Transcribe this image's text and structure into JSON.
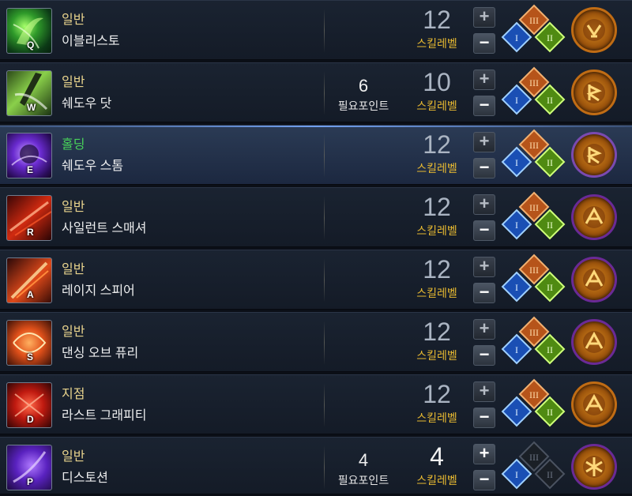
{
  "skills": [
    {
      "key": "Q",
      "type": "일반",
      "name": "이블리스토",
      "points": "",
      "points_label": "",
      "level": "12",
      "level_label": "스킬레벨",
      "tripods": [
        "III",
        "I",
        "II"
      ],
      "rune": "gold"
    },
    {
      "key": "W",
      "type": "일반",
      "name": "쉐도우 닷",
      "points": "6",
      "points_label": "필요포인트",
      "level": "10",
      "level_label": "스킬레벨",
      "tripods": [
        "III",
        "I",
        "II"
      ],
      "rune": "gold"
    },
    {
      "key": "E",
      "type": "홀딩",
      "name": "쉐도우 스톰",
      "points": "",
      "points_label": "",
      "level": "12",
      "level_label": "스킬레벨",
      "tripods": [
        "III",
        "I",
        "II"
      ],
      "rune": "gold"
    },
    {
      "key": "R",
      "type": "일반",
      "name": "사일런트 스매셔",
      "points": "",
      "points_label": "",
      "level": "12",
      "level_label": "스킬레벨",
      "tripods": [
        "III",
        "I",
        "II"
      ],
      "rune": "purple"
    },
    {
      "key": "A",
      "type": "일반",
      "name": "레이지 스피어",
      "points": "",
      "points_label": "",
      "level": "12",
      "level_label": "스킬레벨",
      "tripods": [
        "III",
        "I",
        "II"
      ],
      "rune": "purple"
    },
    {
      "key": "S",
      "type": "일반",
      "name": "댄싱 오브 퓨리",
      "points": "",
      "points_label": "",
      "level": "12",
      "level_label": "스킬레벨",
      "tripods": [
        "III",
        "I",
        "II"
      ],
      "rune": "purple"
    },
    {
      "key": "D",
      "type": "지점",
      "name": "라스트 그래피티",
      "points": "",
      "points_label": "",
      "level": "12",
      "level_label": "스킬레벨",
      "tripods": [
        "III",
        "I",
        "II"
      ],
      "rune": "gold"
    },
    {
      "key": "P",
      "type": "일반",
      "name": "디스토션",
      "points": "4",
      "points_label": "필요포인트",
      "level": "4",
      "level_label": "스킬레벨",
      "tripods": [
        "III",
        "I",
        "II"
      ],
      "rune": "purple"
    }
  ],
  "buttons": {
    "plus": "+",
    "minus": "−"
  },
  "colors": {
    "type_normal": "#e9d48d",
    "type_holding": "#48d35a",
    "level_label": "#e7b931"
  }
}
